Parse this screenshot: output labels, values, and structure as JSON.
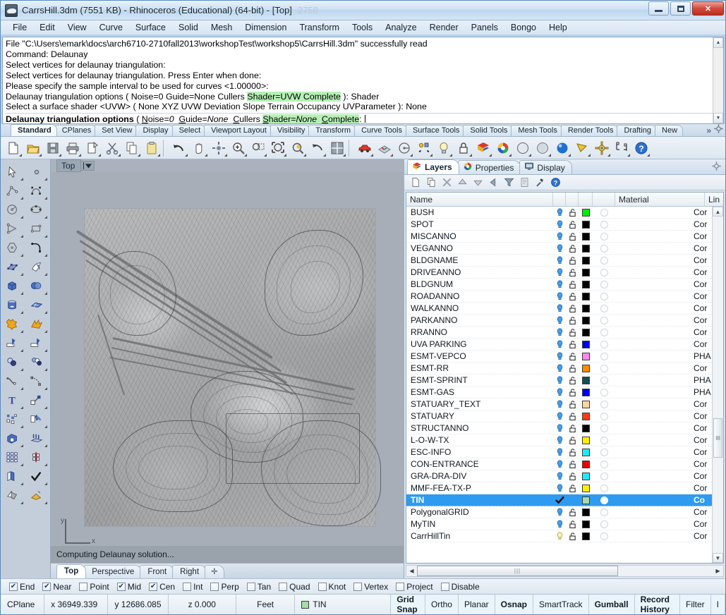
{
  "window": {
    "title": "CarrsHill.3dm (7551 KB) - Rhinoceros (Educational) (64-bit) - [Top]",
    "ghost_title": "2758",
    "minimize_label": "Minimize",
    "maximize_label": "Maximize",
    "close_label": "✕"
  },
  "menu": {
    "items": [
      "File",
      "Edit",
      "View",
      "Curve",
      "Surface",
      "Solid",
      "Mesh",
      "Dimension",
      "Transform",
      "Tools",
      "Analyze",
      "Render",
      "Panels",
      "Bongo",
      "Help"
    ]
  },
  "command_history": {
    "lines": [
      "File \"C:\\Users\\emark\\docs\\arch6710-2710fall2013\\workshopTest\\workshop5\\CarrsHill.3dm\" successfully read",
      "Command: Delaunay",
      "Select vertices for delaunay triangulation:",
      "Select vertices for delaunay triangulation. Press Enter when done:",
      "Please specify the sample interval to be used for curves <1.00000>:"
    ],
    "line_shader": {
      "pre": "Delaunay triangulation options ( Noise=0  Guide=None  Cullers ",
      "hl": "Shader=UVW  Complete",
      "post": " ): Shader"
    },
    "line_surface_shader": "Select a surface shader <UVW> ( None  XYZ  UVW  Deviation  Slope  Terrain  Occupancy  UVParameter ): None",
    "prompt": {
      "bold_head": "Delaunay triangulation options",
      "paren_open": " ( ",
      "opt_noise_k": "N",
      "opt_noise_rest": "oise=",
      "opt_noise_val": "0",
      "opt_guide_k": "G",
      "opt_guide_rest": "uide=",
      "opt_guide_val": "None",
      "opt_cullers_k": "C",
      "opt_cullers_rest": "ullers",
      "opt_shader_k": "S",
      "opt_shader_rest": "hader=",
      "opt_shader_val": "None",
      "opt_complete_k": "C",
      "opt_complete_rest": "omplete",
      "colon": ":"
    }
  },
  "toolbar_tabs": {
    "items": [
      "Standard",
      "CPlanes",
      "Set View",
      "Display",
      "Select",
      "Viewport Layout",
      "Visibility",
      "Transform",
      "Curve Tools",
      "Surface Tools",
      "Solid Tools",
      "Mesh Tools",
      "Render Tools",
      "Drafting",
      "New"
    ],
    "active": "Standard",
    "overflow_label": "»",
    "gear_icon": "gear-icon"
  },
  "main_toolbar": {
    "buttons": [
      {
        "name": "new-file-icon",
        "label": "New"
      },
      {
        "name": "open-file-icon",
        "label": "Open"
      },
      {
        "name": "save-file-icon",
        "label": "Save"
      },
      {
        "name": "print-icon",
        "label": "Print"
      },
      {
        "name": "copy-to-clipboard-icon",
        "label": "Copy to clipboard"
      },
      {
        "name": "cut-icon",
        "label": "Cut"
      },
      {
        "name": "copy-icon",
        "label": "Copy"
      },
      {
        "name": "paste-icon",
        "label": "Paste"
      },
      {
        "name": "undo-icon",
        "label": "Undo"
      },
      {
        "name": "pan-icon",
        "label": "Pan"
      },
      {
        "name": "rotate-view-icon",
        "label": "Rotate view"
      },
      {
        "name": "zoom-in-icon",
        "label": "Zoom in"
      },
      {
        "name": "zoom-window-icon",
        "label": "Zoom window"
      },
      {
        "name": "zoom-extents-icon",
        "label": "Zoom extents"
      },
      {
        "name": "zoom-selected-icon",
        "label": "Zoom selected"
      },
      {
        "name": "undo-view-icon",
        "label": "Undo view change"
      },
      {
        "name": "four-viewport-icon",
        "label": "4 viewports"
      },
      {
        "name": "car-icon",
        "label": "Render preview"
      },
      {
        "name": "cplane-icon",
        "label": "Set CPlane"
      },
      {
        "name": "named-view-icon",
        "label": "Named views"
      },
      {
        "name": "select-objects-icon",
        "label": "Select objects"
      },
      {
        "name": "light-bulb-icon",
        "label": "Lights"
      },
      {
        "name": "lock-icon",
        "label": "Lock object"
      },
      {
        "name": "layers-icon",
        "label": "Layers"
      },
      {
        "name": "color-wheel-icon",
        "label": "Object color"
      },
      {
        "name": "shaded-sphere-icon",
        "label": "Shaded viewport"
      },
      {
        "name": "ghosted-sphere-icon",
        "label": "Ghosted viewport"
      },
      {
        "name": "rendered-sphere-icon",
        "label": "Rendered viewport"
      },
      {
        "name": "render-cone-icon",
        "label": "Render"
      },
      {
        "name": "options-gear-icon",
        "label": "Options"
      },
      {
        "name": "dimension-icon",
        "label": "Dimension"
      },
      {
        "name": "help-icon",
        "label": "Help"
      }
    ]
  },
  "left_toolbar": {
    "buttons": [
      {
        "name": "select-arrow-icon"
      },
      {
        "name": "point-icon"
      },
      {
        "name": "polyline-icon"
      },
      {
        "name": "control-point-curve-icon"
      },
      {
        "name": "circle-icon"
      },
      {
        "name": "ellipse-icon"
      },
      {
        "name": "triangle-polygon-icon"
      },
      {
        "name": "rectangle-icon"
      },
      {
        "name": "polygon-icon"
      },
      {
        "name": "curve-fillet-icon"
      },
      {
        "name": "surface-from-points-icon"
      },
      {
        "name": "surface-sweep-icon"
      },
      {
        "name": "box-icon"
      },
      {
        "name": "sphere-boolean-icon"
      },
      {
        "name": "cylinder-icon"
      },
      {
        "name": "mesh-plane-icon"
      },
      {
        "name": "boolean-union-icon"
      },
      {
        "name": "explode-icon"
      },
      {
        "name": "trim-icon"
      },
      {
        "name": "split-icon"
      },
      {
        "name": "fillet-icon"
      },
      {
        "name": "chamfer-icon"
      },
      {
        "name": "offset-circle-icon"
      },
      {
        "name": "offset-curve-icon"
      },
      {
        "name": "text-icon"
      },
      {
        "name": "scale-icon"
      },
      {
        "name": "array-icon"
      },
      {
        "name": "rotate-icon"
      },
      {
        "name": "extrude-solid-icon"
      },
      {
        "name": "extrude-surface-icon"
      },
      {
        "name": "rectangular-array-icon"
      },
      {
        "name": "mirror-icon"
      },
      {
        "name": "copy-objects-icon"
      },
      {
        "name": "check-object-icon"
      },
      {
        "name": "shade-icon"
      },
      {
        "name": "render-mesh-icon"
      }
    ]
  },
  "viewport": {
    "title": "Top",
    "dropdown_icon": "chevron-down-icon",
    "axis_x_label": "x",
    "axis_y_label": "y",
    "status_message": "Computing Delaunay solution...",
    "tabs": [
      "Top",
      "Perspective",
      "Front",
      "Right"
    ],
    "active_tab": "Top",
    "add_tab_label": "✛"
  },
  "right_panel": {
    "tabs": [
      {
        "label": "Layers",
        "icon": "layers-icon",
        "active": true
      },
      {
        "label": "Properties",
        "icon": "color-wheel-icon",
        "active": false
      },
      {
        "label": "Display",
        "icon": "monitor-icon",
        "active": false
      }
    ],
    "gear_icon": "gear-icon",
    "tool_buttons": [
      {
        "name": "new-layer-icon"
      },
      {
        "name": "duplicate-layer-icon"
      },
      {
        "name": "delete-layer-icon"
      },
      {
        "name": "move-layer-up-icon"
      },
      {
        "name": "move-layer-down-icon"
      },
      {
        "name": "move-layer-left-icon"
      },
      {
        "name": "filter-icon"
      },
      {
        "name": "layer-properties-icon"
      },
      {
        "name": "layer-tools-icon"
      },
      {
        "name": "help-icon"
      }
    ],
    "columns": [
      "Name",
      "Material",
      "Lin"
    ],
    "layers": [
      {
        "name": "BUSH",
        "color": "#00ee00",
        "visible": true,
        "locked": false,
        "linetype": "Cor"
      },
      {
        "name": "SPOT",
        "color": "#000000",
        "visible": true,
        "locked": false,
        "linetype": "Cor"
      },
      {
        "name": "MISCANNO",
        "color": "#000000",
        "visible": true,
        "locked": false,
        "linetype": "Cor"
      },
      {
        "name": "VEGANNO",
        "color": "#000000",
        "visible": true,
        "locked": false,
        "linetype": "Cor"
      },
      {
        "name": "BLDGNAME",
        "color": "#000000",
        "visible": true,
        "locked": false,
        "linetype": "Cor"
      },
      {
        "name": "DRIVEANNO",
        "color": "#000000",
        "visible": true,
        "locked": false,
        "linetype": "Cor"
      },
      {
        "name": "BLDGNUM",
        "color": "#000000",
        "visible": true,
        "locked": false,
        "linetype": "Cor"
      },
      {
        "name": "ROADANNO",
        "color": "#000000",
        "visible": true,
        "locked": false,
        "linetype": "Cor"
      },
      {
        "name": "WALKANNO",
        "color": "#000000",
        "visible": true,
        "locked": false,
        "linetype": "Cor"
      },
      {
        "name": "PARKANNO",
        "color": "#000000",
        "visible": true,
        "locked": false,
        "linetype": "Cor"
      },
      {
        "name": "RRANNO",
        "color": "#000000",
        "visible": true,
        "locked": false,
        "linetype": "Cor"
      },
      {
        "name": "UVA PARKING",
        "color": "#0000ee",
        "visible": true,
        "locked": false,
        "linetype": "Cor"
      },
      {
        "name": "ESMT-VEPCO",
        "color": "#ff8ae6",
        "visible": true,
        "locked": false,
        "linetype": "PHA"
      },
      {
        "name": "ESMT-RR",
        "color": "#ff8c00",
        "visible": true,
        "locked": false,
        "linetype": "Cor"
      },
      {
        "name": "ESMT-SPRINT",
        "color": "#134e4e",
        "visible": true,
        "locked": false,
        "linetype": "PHA"
      },
      {
        "name": "ESMT-GAS",
        "color": "#0000ee",
        "visible": true,
        "locked": false,
        "linetype": "PHA"
      },
      {
        "name": "STATUARY_TEXT",
        "color": "#fad6a0",
        "visible": true,
        "locked": false,
        "linetype": "Cor"
      },
      {
        "name": "STATUARY",
        "color": "#ff3c14",
        "visible": true,
        "locked": false,
        "linetype": "Cor"
      },
      {
        "name": "STRUCTANNO",
        "color": "#000000",
        "visible": true,
        "locked": false,
        "linetype": "Cor"
      },
      {
        "name": "L-O-W-TX",
        "color": "#ffee00",
        "visible": true,
        "locked": false,
        "linetype": "Cor"
      },
      {
        "name": "ESC-INFO",
        "color": "#24e8f6",
        "visible": true,
        "locked": false,
        "linetype": "Cor"
      },
      {
        "name": "CON-ENTRANCE",
        "color": "#ee0000",
        "visible": true,
        "locked": false,
        "linetype": "Cor"
      },
      {
        "name": "GRA-DRA-DIV",
        "color": "#24e8f6",
        "visible": true,
        "locked": false,
        "linetype": "Cor"
      },
      {
        "name": "MMF-FEA-TX-P",
        "color": "#ffee00",
        "visible": true,
        "locked": false,
        "linetype": "Cor"
      },
      {
        "name": "TIN",
        "color": "#a8dba8",
        "visible": true,
        "locked": false,
        "linetype": "Co",
        "selected": true,
        "current": true
      },
      {
        "name": "PolygonalGRID",
        "color": "#000000",
        "visible": true,
        "locked": false,
        "linetype": "Cor"
      },
      {
        "name": "MyTIN",
        "color": "#000000",
        "visible": true,
        "locked": false,
        "linetype": "Cor"
      },
      {
        "name": "CarrHillTin",
        "color": "#000000",
        "visible": false,
        "locked": false,
        "linetype": "Cor"
      }
    ]
  },
  "osnap": {
    "items": [
      {
        "label": "End",
        "checked": true
      },
      {
        "label": "Near",
        "checked": true
      },
      {
        "label": "Point",
        "checked": false
      },
      {
        "label": "Mid",
        "checked": true
      },
      {
        "label": "Cen",
        "checked": true
      },
      {
        "label": "Int",
        "checked": false
      },
      {
        "label": "Perp",
        "checked": false
      },
      {
        "label": "Tan",
        "checked": false
      },
      {
        "label": "Quad",
        "checked": false
      },
      {
        "label": "Knot",
        "checked": false
      },
      {
        "label": "Vertex",
        "checked": false
      },
      {
        "label": "Project",
        "checked": false
      },
      {
        "label": "Disable",
        "checked": false
      }
    ]
  },
  "status_bar": {
    "cplane_label": "CPlane",
    "x_value": "x 36949.339",
    "y_value": "y 12686.085",
    "z_value": "z 0.000",
    "units": "Feet",
    "layer_name": "TIN",
    "layer_color": "#a8dba8",
    "toggles": [
      {
        "label": "Grid Snap",
        "on": true
      },
      {
        "label": "Ortho",
        "on": false
      },
      {
        "label": "Planar",
        "on": false
      },
      {
        "label": "Osnap",
        "on": true
      },
      {
        "label": "SmartTrack",
        "on": false
      },
      {
        "label": "Gumball",
        "on": true
      },
      {
        "label": "Record History",
        "on": true
      },
      {
        "label": "Filter",
        "on": false
      },
      {
        "label": "I",
        "on": false
      }
    ]
  }
}
